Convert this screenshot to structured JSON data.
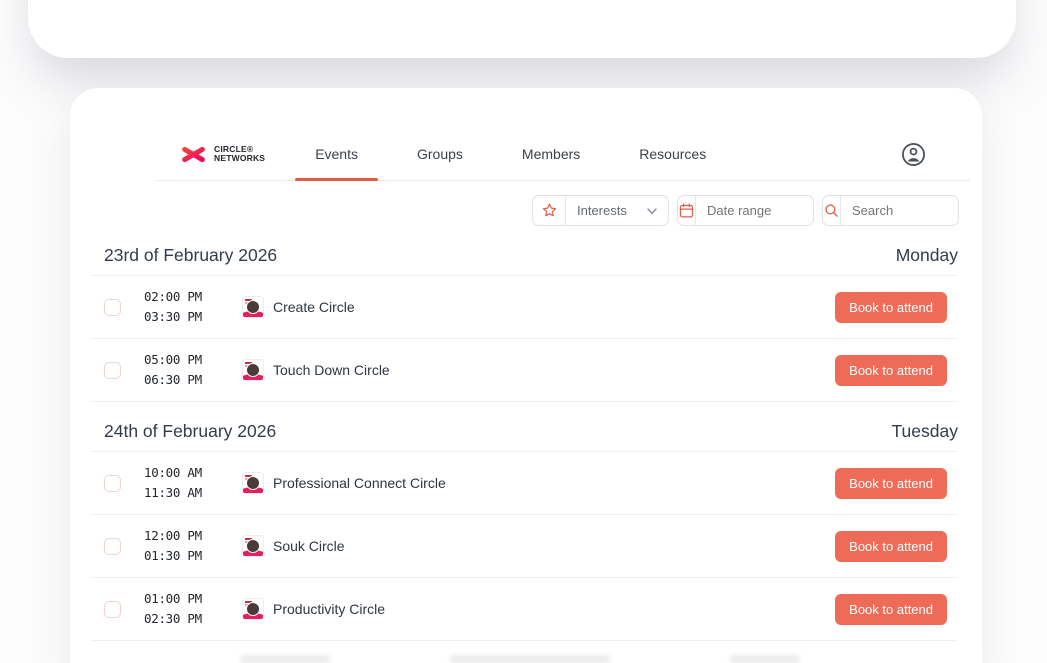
{
  "brand": {
    "line1": "CIRCLE®",
    "line2": "NETWORKS"
  },
  "nav": {
    "tabs": [
      {
        "label": "Events",
        "active": true
      },
      {
        "label": "Groups",
        "active": false
      },
      {
        "label": "Members",
        "active": false
      },
      {
        "label": "Resources",
        "active": false
      }
    ]
  },
  "filters": {
    "interests_label": "Interests",
    "date_range_placeholder": "Date range",
    "search_placeholder": "Search"
  },
  "book_button_label": "Book to attend",
  "colors": {
    "accent_coral": "#ed6b57",
    "tab_underline": "#e25c45",
    "brand_pink": "#e60a64",
    "icon_coral": "#dd5f47"
  },
  "days": [
    {
      "date": "23rd of February 2026",
      "weekday": "Monday",
      "events": [
        {
          "start": "02:00 PM",
          "end": "03:30 PM",
          "name": "Create Circle"
        },
        {
          "start": "05:00 PM",
          "end": "06:30 PM",
          "name": "Touch Down Circle"
        }
      ]
    },
    {
      "date": "24th of February 2026",
      "weekday": "Tuesday",
      "events": [
        {
          "start": "10:00 AM",
          "end": "11:30 AM",
          "name": "Professional Connect Circle"
        },
        {
          "start": "12:00 PM",
          "end": "01:30 PM",
          "name": "Souk Circle"
        },
        {
          "start": "01:00 PM",
          "end": "02:30 PM",
          "name": "Productivity Circle"
        }
      ]
    }
  ]
}
